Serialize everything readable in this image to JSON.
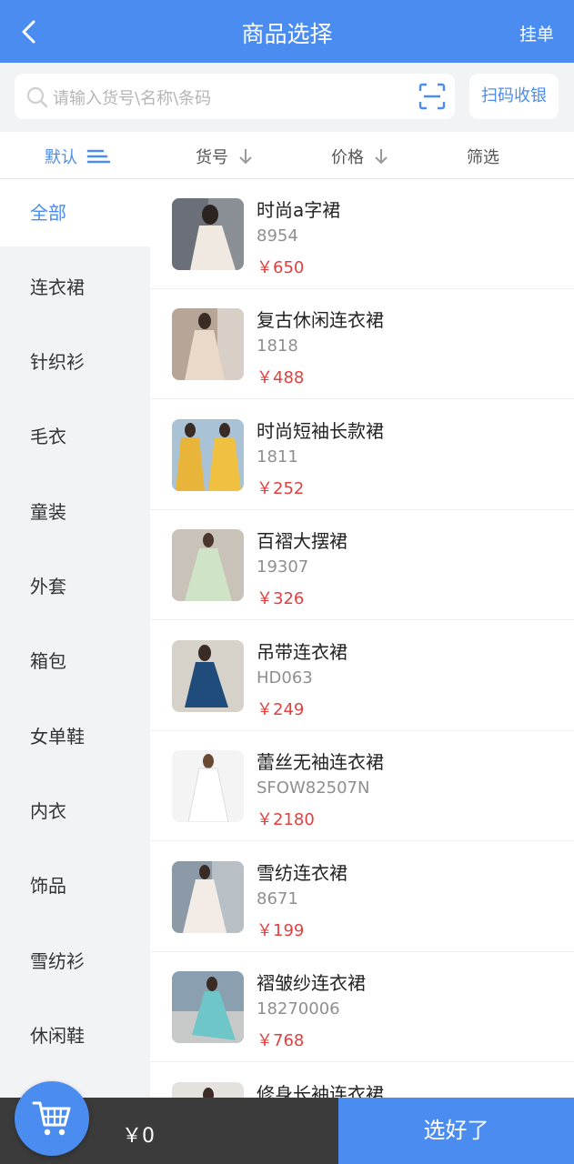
{
  "header": {
    "title": "商品选择",
    "right_action": "挂单"
  },
  "search": {
    "placeholder": "请输入货号\\名称\\条码",
    "scan_button": "扫码收银"
  },
  "sort": {
    "default": "默认",
    "code": "货号",
    "price": "价格",
    "filter": "筛选"
  },
  "categories": [
    "全部",
    "连衣裙",
    "针织衫",
    "毛衣",
    "童装",
    "外套",
    "箱包",
    "女单鞋",
    "内衣",
    "饰品",
    "雪纺衫",
    "休闲鞋"
  ],
  "active_category": "全部",
  "products": [
    {
      "name": "时尚a字裙",
      "code": "8954",
      "price": "￥650"
    },
    {
      "name": "复古休闲连衣裙",
      "code": "1818",
      "price": "￥488"
    },
    {
      "name": "时尚短袖长款裙",
      "code": "1811",
      "price": "￥252"
    },
    {
      "name": "百褶大摆裙",
      "code": "19307",
      "price": "￥326"
    },
    {
      "name": "吊带连衣裙",
      "code": "HD063",
      "price": "￥249"
    },
    {
      "name": "蕾丝无袖连衣裙",
      "code": "SFOW82507N",
      "price": "￥2180"
    },
    {
      "name": "雪纺连衣裙",
      "code": "8671",
      "price": "￥199"
    },
    {
      "name": "褶皱纱连衣裙",
      "code": "18270006",
      "price": "￥768"
    },
    {
      "name": "修身长袖连衣裙",
      "code": "",
      "price": ""
    }
  ],
  "footer": {
    "total": "￥0",
    "confirm": "选好了"
  },
  "colors": {
    "accent": "#4a8cf0",
    "price": "#e2403f",
    "footer_dark": "#3b3b3b"
  },
  "icons": [
    "back-arrow-icon",
    "search-icon",
    "scan-icon",
    "sort-lines-icon",
    "arrow-down-icon",
    "cart-icon"
  ]
}
